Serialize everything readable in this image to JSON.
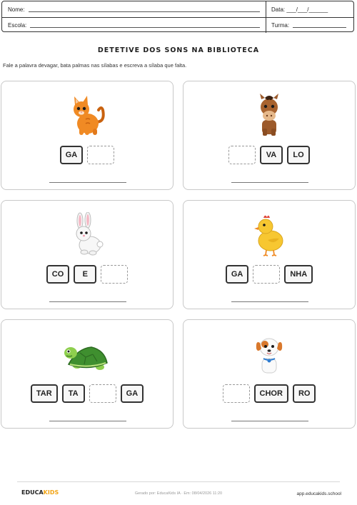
{
  "header": {
    "name_label": "Nome:",
    "date_label": "Data: ___/___/______",
    "school_label": "Escola:",
    "class_label": "Turma:"
  },
  "title": "DETETIVE DOS SONS NA BIBLIOTECA",
  "instruction": "Fale a palavra devagar, bata palmas nas sílabas e escreva a sílaba que falta.",
  "cards": [
    {
      "animal_icon": "cat-icon",
      "syllables": [
        "GA",
        ""
      ]
    },
    {
      "animal_icon": "horse-icon",
      "syllables": [
        "",
        "VA",
        "LO"
      ]
    },
    {
      "animal_icon": "rabbit-icon",
      "syllables": [
        "CO",
        "E",
        ""
      ]
    },
    {
      "animal_icon": "chick-icon",
      "syllables": [
        "GA",
        "",
        "NHA"
      ]
    },
    {
      "animal_icon": "turtle-icon",
      "syllables": [
        "TAR",
        "TA",
        "",
        "GA"
      ]
    },
    {
      "animal_icon": "dog-icon",
      "syllables": [
        "",
        "CHOR",
        "RO"
      ]
    }
  ],
  "footer": {
    "logo_part1": "EDUCA",
    "logo_part2": "KIDS",
    "generated": "Gerado por: EducaKids IA · Em: 08/04/2026 11:20",
    "url": "app.educakids.school"
  },
  "colors": {
    "logo_accent": "#f2a516",
    "card_border": "#c8c8c8",
    "tile_border": "#333333"
  }
}
